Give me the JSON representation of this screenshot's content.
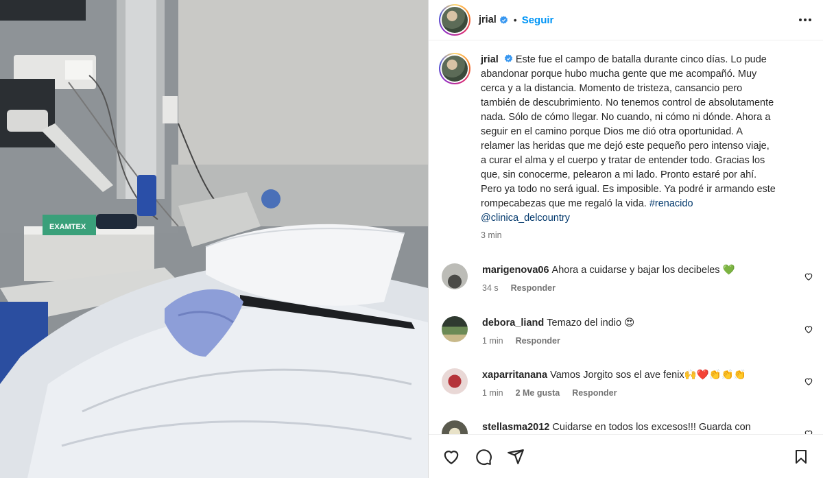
{
  "post": {
    "username": "jrial",
    "dot": "•",
    "follow_label": "Seguir",
    "caption_username": "jrial",
    "caption_text": "Este fue el campo de batalla durante cinco días. Lo pude abandonar porque hubo mucha gente que me acompañó. Muy cerca y a la distancia. Momento de tristeza, cansancio pero también de descubrimiento. No tenemos control de absolutamente nada. Sólo de cómo llegar. No cuando, ni cómo ni dónde. Ahora a seguir en el camino porque Dios me dió otra oportunidad. A relamer las heridas que me dejó este pequeño pero intenso viaje, a curar el alma y el cuerpo y tratar de entender todo. Gracias los que, sin conocerme, pelearon a mi lado. Pronto estaré por ahí. Pero ya todo no será igual. Es imposible. Ya podré ir armando este rompecabezas que me regaló la vida.",
    "hashtag": "#renacido",
    "mention": "@clinica_delcountry",
    "caption_time": "3 min"
  },
  "photo": {
    "box_label": "EXAMTEX"
  },
  "comments": [
    {
      "username": "marigenova06",
      "text": "Ahora a cuidarse y bajar los decibeles",
      "emoji": "💚",
      "time": "34 s",
      "likes": "",
      "reply": "Responder"
    },
    {
      "username": "debora_liand",
      "text": "Temazo del indio",
      "emoji": "😍",
      "time": "1 min",
      "likes": "",
      "reply": "Responder"
    },
    {
      "username": "xaparritanana",
      "text": "Vamos Jorgito sos el ave fenix",
      "emoji": "🙌❤️👏👏👏",
      "time": "1 min",
      "likes": "2 Me gusta",
      "reply": "Responder"
    },
    {
      "username": "stellasma2012",
      "text": "Cuidarse en todos los excesos!!! Guarda con",
      "emoji": "",
      "time": "",
      "likes": "",
      "reply": ""
    }
  ],
  "icons": {
    "verified": "verified-badge-icon",
    "more": "more-options-icon",
    "like": "heart-icon",
    "comment": "comment-icon",
    "share": "share-icon",
    "save": "bookmark-icon"
  },
  "colors": {
    "accent": "#0095f6",
    "text": "#262626",
    "muted": "#737373",
    "verified": "#3897f0"
  }
}
